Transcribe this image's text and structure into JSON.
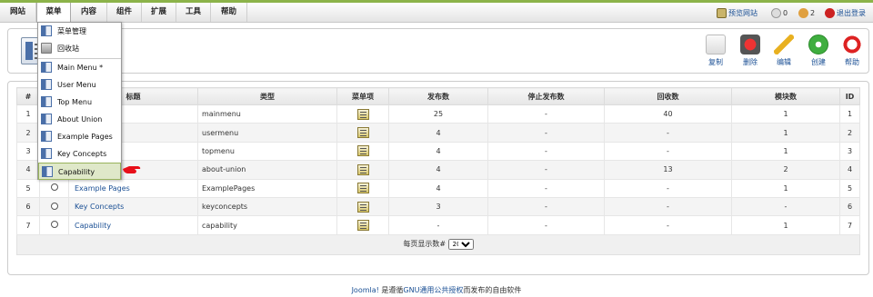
{
  "menubar": {
    "items": [
      "网站",
      "菜单",
      "内容",
      "组件",
      "扩展",
      "工具",
      "帮助"
    ],
    "status": {
      "preview": "预览网站",
      "messages": "0",
      "users": "2",
      "logout": "退出登录"
    }
  },
  "dropdown": {
    "items": [
      "菜单管理",
      "回收站",
      "Main Menu *",
      "User Menu",
      "Top Menu",
      "About Union",
      "Example Pages",
      "Key Concepts",
      "Capability"
    ]
  },
  "toolbar": {
    "copy": "复制",
    "delete": "删除",
    "edit": "编辑",
    "new": "创建",
    "help": "帮助"
  },
  "table": {
    "headers": [
      "#",
      "",
      "标题",
      "类型",
      "菜单项",
      "发布数",
      "停止发布数",
      "回收数",
      "模块数",
      "ID"
    ],
    "rows": [
      {
        "num": "1",
        "title": "",
        "type": "mainmenu",
        "published": "25",
        "unpublished": "-",
        "trashed": "40",
        "modules": "1",
        "id": "1"
      },
      {
        "num": "2",
        "title": "",
        "type": "usermenu",
        "published": "4",
        "unpublished": "-",
        "trashed": "-",
        "modules": "1",
        "id": "2"
      },
      {
        "num": "3",
        "title": "",
        "type": "topmenu",
        "published": "4",
        "unpublished": "-",
        "trashed": "-",
        "modules": "1",
        "id": "3"
      },
      {
        "num": "4",
        "title": "",
        "type": "about-union",
        "published": "4",
        "unpublished": "-",
        "trashed": "13",
        "modules": "2",
        "id": "4"
      },
      {
        "num": "5",
        "title": "Example Pages",
        "type": "ExamplePages",
        "published": "4",
        "unpublished": "-",
        "trashed": "-",
        "modules": "1",
        "id": "5"
      },
      {
        "num": "6",
        "title": "Key Concepts",
        "type": "keyconcepts",
        "published": "3",
        "unpublished": "-",
        "trashed": "-",
        "modules": "-",
        "id": "6"
      },
      {
        "num": "7",
        "title": "Capability",
        "type": "capability",
        "published": "-",
        "unpublished": "-",
        "trashed": "-",
        "modules": "1",
        "id": "7"
      }
    ],
    "per_page_label": "每页显示数#",
    "per_page_value": "20"
  },
  "footer": {
    "link1": "Joomla!",
    "text1": " 是遵循",
    "link2": "GNU通用公共授权",
    "text2": "而发布的自由软件"
  },
  "colors": {
    "accent": "#8cb34a",
    "link": "#1a4f94",
    "highlight": "#dfe8c9"
  }
}
